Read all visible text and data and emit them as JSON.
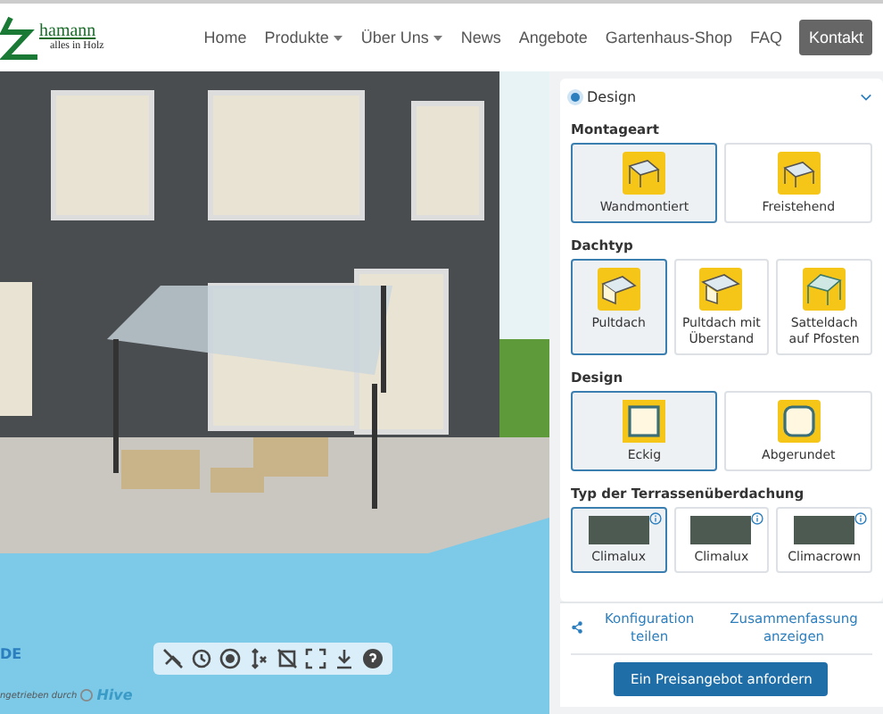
{
  "header": {
    "logo": {
      "name": "hamann",
      "tagline": "alles in Holz"
    },
    "nav": [
      {
        "label": "Home",
        "dropdown": false,
        "selected": false
      },
      {
        "label": "Produkte",
        "dropdown": true,
        "selected": false
      },
      {
        "label": "Über Uns",
        "dropdown": true,
        "selected": false
      },
      {
        "label": "News",
        "dropdown": false,
        "selected": false
      },
      {
        "label": "Angebote",
        "dropdown": false,
        "selected": false
      },
      {
        "label": "Gartenhaus-Shop",
        "dropdown": false,
        "selected": false
      },
      {
        "label": "FAQ",
        "dropdown": false,
        "selected": false
      },
      {
        "label": "Kontakt",
        "dropdown": false,
        "selected": true
      }
    ]
  },
  "viewer": {
    "language": "DE",
    "powered_by": "ngetrieben durch",
    "brand": "Hive"
  },
  "panel": {
    "section": {
      "title": "Design",
      "expanded": true
    },
    "groups": [
      {
        "title": "Montageart",
        "options": [
          {
            "label": "Wandmontiert",
            "kind": "wall",
            "selected": true
          },
          {
            "label": "Freistehend",
            "kind": "free",
            "selected": false
          }
        ]
      },
      {
        "title": "Dachtyp",
        "options": [
          {
            "label": "Pultdach",
            "kind": "mono",
            "selected": true
          },
          {
            "label": "Pultdach mit Überstand",
            "kind": "overhang",
            "selected": false
          },
          {
            "label": "Satteldach auf Pfosten",
            "kind": "gable",
            "selected": false
          }
        ]
      },
      {
        "title": "Design",
        "options": [
          {
            "label": "Eckig",
            "kind": "square",
            "selected": true
          },
          {
            "label": "Abgerundet",
            "kind": "rounded",
            "selected": false
          }
        ]
      },
      {
        "title": "Typ der Terrassenüberdachung",
        "options": [
          {
            "label": "Climalux",
            "kind": "photo",
            "selected": true
          },
          {
            "label": "Climalux",
            "kind": "photo",
            "selected": false
          },
          {
            "label": "Climacrown",
            "kind": "photo",
            "selected": false
          }
        ]
      }
    ],
    "share": "Konfiguration teilen",
    "summary": "Zusammenfassung anzeigen",
    "quote_button": "Ein Preisangebot anfordern"
  }
}
